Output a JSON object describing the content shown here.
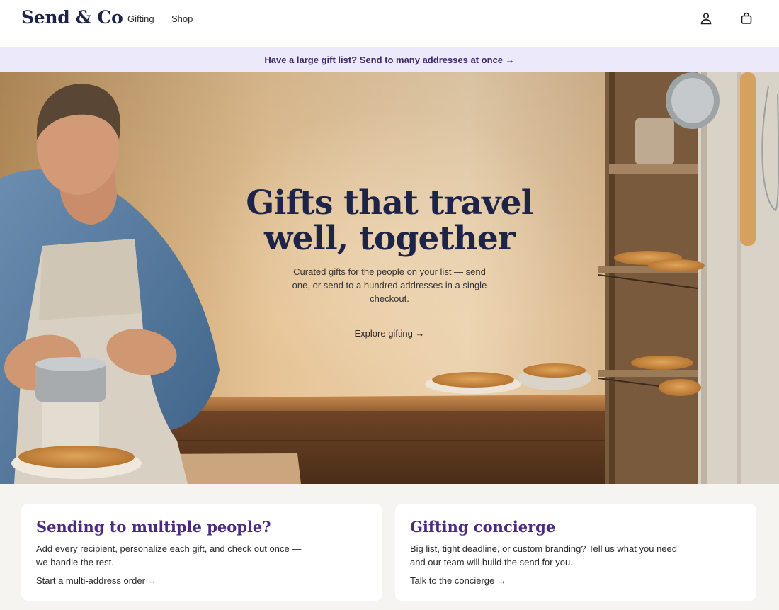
{
  "header": {
    "logo": "Send & Co",
    "nav": [
      {
        "label": "Gifting"
      },
      {
        "label": "Shop"
      }
    ],
    "icons": {
      "account": "user-icon",
      "cart": "shopping-bag-icon"
    }
  },
  "banner": {
    "text": "Have a large gift list? Send to many addresses at once →"
  },
  "hero": {
    "title": "Gifts that travel well, together",
    "subtitle": "Curated gifts for the people on your list — send one, or send to a hundred addresses in a single checkout.",
    "cta": "Explore gifting →"
  },
  "cards": [
    {
      "title": "Sending to multiple people?",
      "body": "Add every recipient, personalize each gift, and check out once — we handle the rest.",
      "link": "Start a multi-address order →"
    },
    {
      "title": "Gifting concierge",
      "body": "Big list, tight deadline, or custom branding? Tell us what you need and our team will build the send for you.",
      "link": "Talk to the concierge →"
    }
  ],
  "colors": {
    "brand_navy": "#1e2448",
    "accent_purple": "#4a2a82",
    "banner_bg": "#ece9fb",
    "page_bg": "#f6f4f0"
  }
}
